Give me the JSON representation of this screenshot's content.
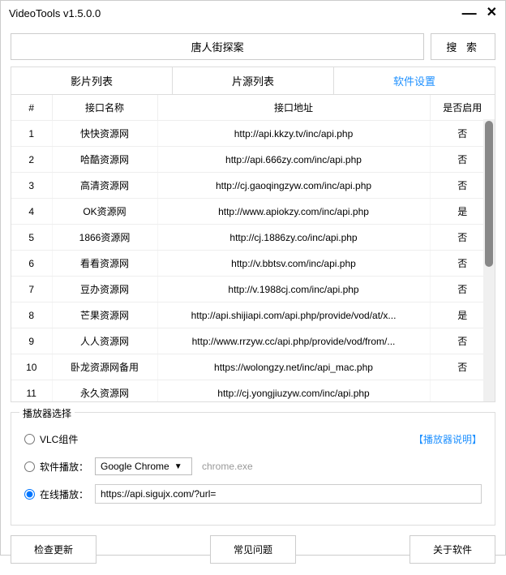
{
  "window": {
    "title": "VideoTools v1.5.0.0"
  },
  "search": {
    "value": "唐人街探案",
    "button": "搜 索"
  },
  "tabs": [
    "影片列表",
    "片源列表",
    "软件设置"
  ],
  "active_tab": 2,
  "table": {
    "headers": {
      "index": "#",
      "name": "接口名称",
      "url": "接口地址",
      "enabled": "是否启用"
    },
    "rows": [
      {
        "idx": "1",
        "name": "快快资源网",
        "url": "http://api.kkzy.tv/inc/api.php",
        "enabled": "否"
      },
      {
        "idx": "2",
        "name": "哈酷资源网",
        "url": "http://api.666zy.com/inc/api.php",
        "enabled": "否"
      },
      {
        "idx": "3",
        "name": "高清资源网",
        "url": "http://cj.gaoqingzyw.com/inc/api.php",
        "enabled": "否"
      },
      {
        "idx": "4",
        "name": "OK资源网",
        "url": "http://www.apiokzy.com/inc/api.php",
        "enabled": "是"
      },
      {
        "idx": "5",
        "name": "1866资源网",
        "url": "http://cj.1886zy.co/inc/api.php",
        "enabled": "否"
      },
      {
        "idx": "6",
        "name": "看看资源网",
        "url": "http://v.bbtsv.com/inc/api.php",
        "enabled": "否"
      },
      {
        "idx": "7",
        "name": "豆办资源网",
        "url": "http://v.1988cj.com/inc/api.php",
        "enabled": "否"
      },
      {
        "idx": "8",
        "name": "芒果资源网",
        "url": "http://api.shijiapi.com/api.php/provide/vod/at/x...",
        "enabled": "是"
      },
      {
        "idx": "9",
        "name": "人人资源网",
        "url": "http://www.rrzyw.cc/api.php/provide/vod/from/...",
        "enabled": "否"
      },
      {
        "idx": "10",
        "name": "卧龙资源网备用",
        "url": "https://wolongzy.net/inc/api_mac.php",
        "enabled": "否"
      },
      {
        "idx": "11",
        "name": "永久资源网",
        "url": "http://cj.yongjiuzyw.com/inc/api.php",
        "enabled": ""
      }
    ]
  },
  "player": {
    "legend": "播放器选择",
    "vlc_label": "VLC组件",
    "help": "【播放器说明】",
    "software_label": "软件播放：",
    "software_select": "Google Chrome",
    "software_exe": "chrome.exe",
    "online_label": "在线播放：",
    "online_url": "https://api.sigujx.com/?url=",
    "selected": "online"
  },
  "bottom": {
    "check_update": "检查更新",
    "faq": "常见问题",
    "about": "关于软件"
  }
}
